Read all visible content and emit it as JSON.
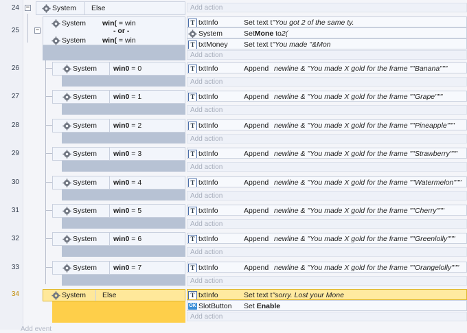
{
  "ui": {
    "add_action": "Add action",
    "add_event": "Add event",
    "or": "- or -",
    "else": "Else",
    "system": "System"
  },
  "events": [
    {
      "line": "24",
      "cond_object": "System",
      "cond_text": "Else"
    },
    {
      "line": "25",
      "conditions": [
        {
          "object": "System",
          "var": "win(",
          "rest": " = win"
        },
        {
          "object": "System",
          "var": "win(",
          "rest": " = win"
        }
      ],
      "actions": [
        {
          "icon": "text-icon",
          "object": "txtInfo",
          "action": "Set text t",
          "param": "\"You got 2 of the same ty."
        },
        {
          "icon": "gear-icon",
          "object": "System",
          "action_pre": "Set",
          "action_bold": "Mone",
          "action_post": " to",
          "param": "2("
        },
        {
          "icon": "text-icon",
          "object": "txtMoney",
          "action": "Set text t",
          "param": "\"You made \"&Mon"
        }
      ]
    },
    {
      "line": "26",
      "var": "win0",
      "rest": "= 0",
      "fruit": "Banana"
    },
    {
      "line": "27",
      "var": "win0",
      "rest": "= 1",
      "fruit": "Grape"
    },
    {
      "line": "28",
      "var": "win0",
      "rest": "= 2",
      "fruit": "Pineapple"
    },
    {
      "line": "29",
      "var": "win0",
      "rest": "= 3",
      "fruit": "Strawberry"
    },
    {
      "line": "30",
      "var": "win0",
      "rest": "= 4",
      "fruit": "Watermelon"
    },
    {
      "line": "31",
      "var": "win0",
      "rest": "= 5",
      "fruit": "Cherry"
    },
    {
      "line": "32",
      "var": "win0",
      "rest": "= 6",
      "fruit": "Greenlolly"
    },
    {
      "line": "33",
      "var": "win0",
      "rest": "= 7",
      "fruit": "Orangelolly"
    },
    {
      "line": "34",
      "cond_object": "System",
      "cond_text": "Else",
      "actions": [
        {
          "icon": "text-icon",
          "object": "txtInfo",
          "action": "Set text t",
          "param": "\"sorry. Lost your Mone"
        },
        {
          "icon": "ok-icon",
          "object": "SlotButton",
          "action_pre": "Set ",
          "action_bold": "Enable"
        }
      ]
    }
  ],
  "sub_action": {
    "object": "txtInfo",
    "action": "Append",
    "param_pre": "newline & \"You made X gold for the frame \"\"",
    "param_post": "\"\"\""
  },
  "colors": {
    "selected": "#ffe89a",
    "selected_fill": "#fecf4a",
    "condition_fill": "#b7c2d4",
    "line_highlight": "#c08a00"
  }
}
